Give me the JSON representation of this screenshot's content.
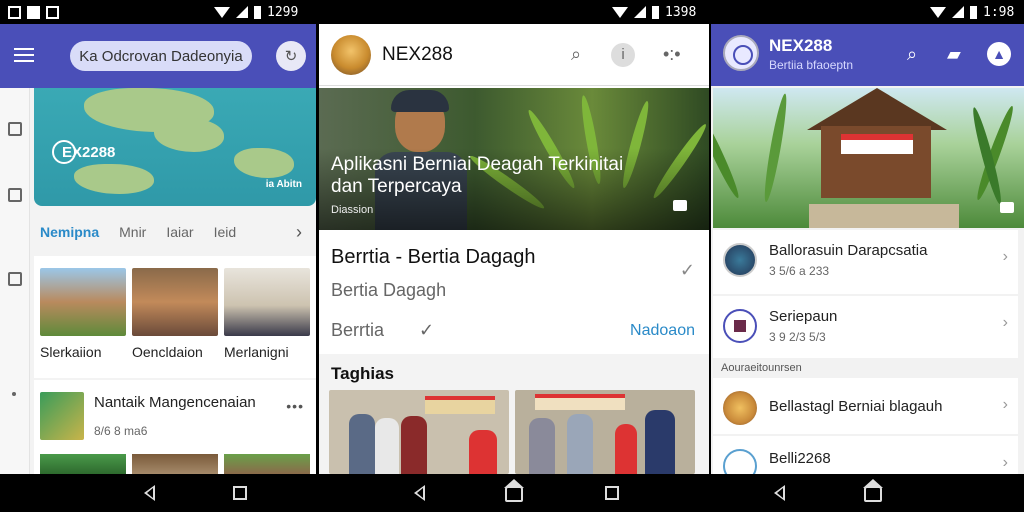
{
  "statusbar": {
    "time_1": "1299",
    "time_2": "1398",
    "time_3": "1:98"
  },
  "panel1": {
    "search_text": "Ka Odcrovan Dadeonyia",
    "map_logo": "EX2288",
    "map_small": "ia Abitn",
    "tabs": [
      "Nemipna",
      "Mnir",
      "Iaiar",
      "Ieid"
    ],
    "grid_captions": [
      "Slerkaiion",
      "Oencldaion",
      "Merlanigni"
    ],
    "card_title": "Nantaik Mangencenaian",
    "card_sub": "8/6 8 ma6"
  },
  "panel2": {
    "title": "NEX288",
    "hero_title": "Aplikasni Berniai Deagah Terkinitai dan Terpercaya",
    "hero_sub": "Diassion",
    "heading": "Berrtia - Bertia Dagagh",
    "subheading": "Bertia Dagagh",
    "label": "Berrtia",
    "link": "Nadoaon",
    "section_title": "Taghias"
  },
  "panel3": {
    "title": "NEX288",
    "subtitle": "Bertiia bfaoeptn",
    "items": [
      {
        "title": "Ballorasuin Darapcsatia",
        "sub": "3 5/6 a 233"
      },
      {
        "title": "Seriepaun",
        "sub": "3 9 2/3 5/3"
      }
    ],
    "section_label": "Aouraeitounrsen",
    "items2": [
      {
        "title": "Bellastagl Berniai blagauh"
      },
      {
        "title": "Belli2268"
      }
    ]
  },
  "icons": {
    "menu": "hamburger-icon",
    "search": "search-icon",
    "info": "info-icon",
    "more": "more-icon",
    "camera": "camera-icon",
    "chevron": "chevron-right-icon",
    "check": "check-icon",
    "cart": "cart-icon",
    "profile": "profile-icon"
  },
  "colors": {
    "primary": "#4a4fb8",
    "accent": "#2a8ac8"
  }
}
